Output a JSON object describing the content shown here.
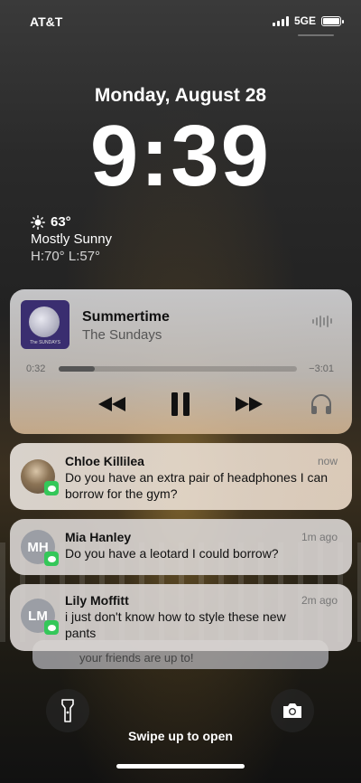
{
  "status": {
    "carrier": "AT&T",
    "network": "5GE"
  },
  "lock": {
    "date": "Monday, August 28",
    "time": "9:39"
  },
  "weather": {
    "temp": "63°",
    "condition": "Mostly Sunny",
    "hilo": "H:70° L:57°"
  },
  "now_playing": {
    "title": "Summertime",
    "artist": "The Sundays",
    "elapsed": "0:32",
    "remaining": "−3:01",
    "progress_fraction": 0.15,
    "album_text": "The SUNDAYS"
  },
  "notifications": [
    {
      "sender": "Chloe Killilea",
      "message": "Do you have an extra pair of headphones I can borrow for the gym?",
      "time": "now",
      "avatar": "photo"
    },
    {
      "sender": "Mia  Hanley",
      "message": "Do you have a leotard I could borrow?",
      "time": "1m ago",
      "initials": "MH"
    },
    {
      "sender": "Lily  Moffitt",
      "message": "i just don't know how to style these new pants",
      "time": "2m ago",
      "initials": "LM"
    }
  ],
  "stacked_hint": "your friends are up to!",
  "swipe_hint": "Swipe up to open",
  "icons": {
    "flashlight": "flashlight-icon",
    "camera": "camera-icon",
    "airplay": "headphones-icon"
  },
  "colors": {
    "messages_green": "#34c759"
  }
}
